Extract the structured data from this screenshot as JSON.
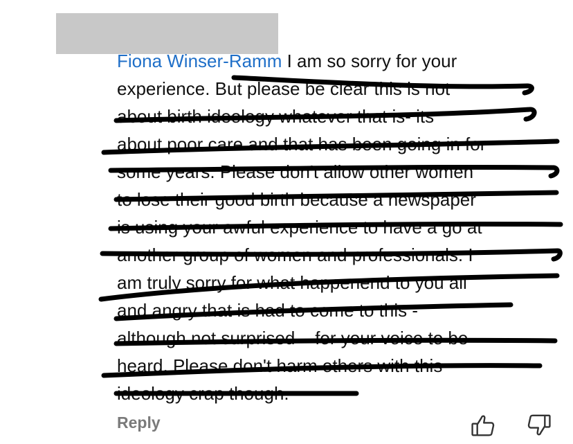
{
  "comment": {
    "author": "Fiona Winser-Ramm",
    "lines": [
      "I am so sorry for your",
      "experience. But please be clear this is not",
      "about birth ideology whatever that is- its",
      "about poor care and that has been going in for",
      "some years. Please don't allow other women",
      "to lose their good birth because a newspaper",
      "is using your awful experience to have a go at",
      "another group of women and professionals. I",
      "am truly sorry for what happenend to you all",
      "and angry that is had to come to this -",
      "although not surprised – for your voice to be",
      "heard. Please don't harm others with this",
      "ideology crap though."
    ]
  },
  "actions": {
    "reply_label": "Reply",
    "like_icon": "thumbs-up-icon",
    "dislike_icon": "thumbs-down-icon"
  },
  "colors": {
    "author_link": "#1f6fc8",
    "text": "#111111",
    "scribble": "#000000",
    "redaction": "#c8c8c8",
    "reply": "#7a7a7a"
  }
}
